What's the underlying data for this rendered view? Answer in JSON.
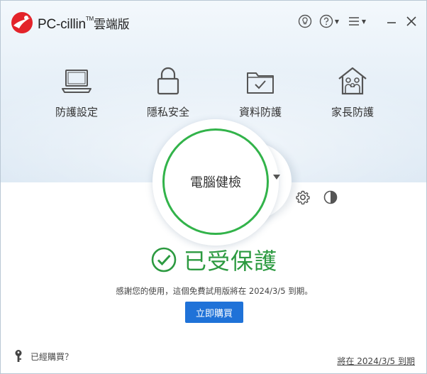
{
  "titlebar": {
    "brand": "PC-cillin",
    "tm": "TM",
    "edition": "雲端版",
    "icons": [
      "lightbulb-icon",
      "help-icon",
      "menu-icon",
      "minimize-icon",
      "close-icon"
    ],
    "accent": "#e3232a"
  },
  "features": [
    {
      "label": "防護設定",
      "icon": "laptop-icon"
    },
    {
      "label": "隱私安全",
      "icon": "lock-icon"
    },
    {
      "label": "資料防護",
      "icon": "folder-check-icon"
    },
    {
      "label": "家長防護",
      "icon": "family-home-icon"
    }
  ],
  "scan": {
    "label": "電腦健檢",
    "ring_color": "#32b34a"
  },
  "status": {
    "text": "已受保護",
    "color": "#2c9a40"
  },
  "trial_note": "感謝您的使用，這個免費試用版將在 2024/3/5 到期。",
  "buy_button": "立即購買",
  "footer": {
    "already_bought": "已經購買？",
    "expiry": "將在 2024/3/5 到期"
  },
  "colors": {
    "button": "#1f72d8"
  }
}
